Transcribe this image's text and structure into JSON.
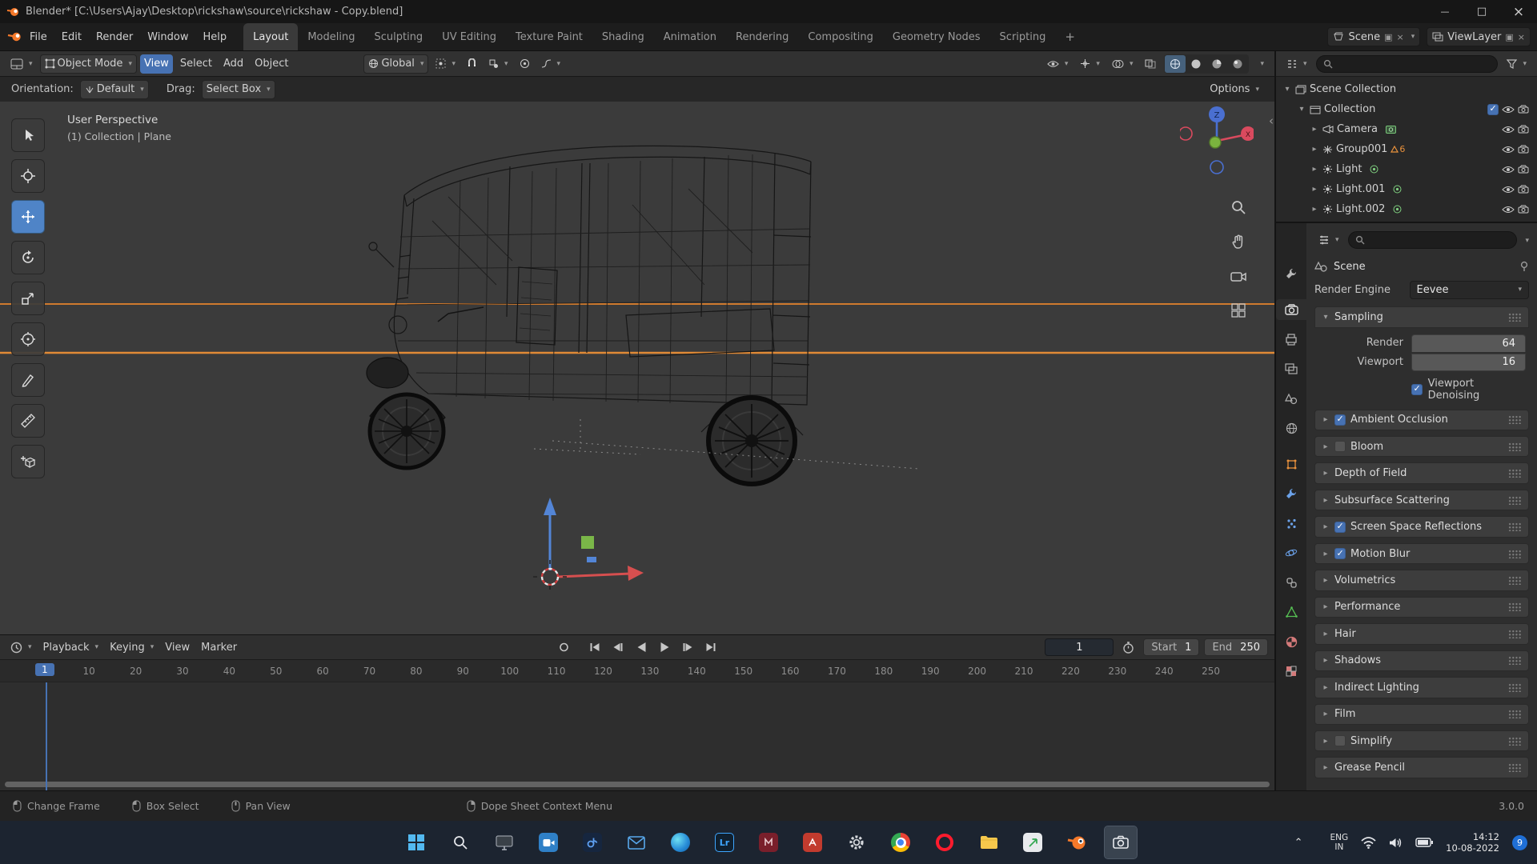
{
  "titlebar": {
    "title": "Blender* [C:\\Users\\Ajay\\Desktop\\rickshaw\\source\\rickshaw - Copy.blend]"
  },
  "topbar": {
    "menus": [
      "File",
      "Edit",
      "Render",
      "Window",
      "Help"
    ],
    "workspaces": [
      "Layout",
      "Modeling",
      "Sculpting",
      "UV Editing",
      "Texture Paint",
      "Shading",
      "Animation",
      "Rendering",
      "Compositing",
      "Geometry Nodes",
      "Scripting"
    ],
    "add_workspace": "+",
    "scene_selector": {
      "label": "Scene"
    },
    "viewlayer_selector": {
      "label": "ViewLayer"
    }
  },
  "viewport": {
    "header": {
      "mode": "Object Mode",
      "menus": [
        "View",
        "Select",
        "Add",
        "Object"
      ],
      "orientation": "Global"
    },
    "toolbar_row": {
      "orientation_label": "Orientation:",
      "orientation_value": "Default",
      "drag_label": "Drag:",
      "drag_value": "Select Box",
      "options_label": "Options"
    },
    "overlay": {
      "view_label": "User Perspective",
      "context_label": "(1) Collection | Plane"
    },
    "gizmo": {
      "z": "Z",
      "x": "X"
    }
  },
  "outliner": {
    "collection_checked": true,
    "items": [
      {
        "label": "Scene Collection"
      },
      {
        "label": "Collection"
      },
      {
        "label": "Camera"
      },
      {
        "label": "Group001",
        "badge": "6"
      },
      {
        "label": "Light"
      },
      {
        "label": "Light.001"
      },
      {
        "label": "Light.002"
      }
    ]
  },
  "properties": {
    "breadcrumb": "Scene",
    "render_engine_label": "Render Engine",
    "render_engine_value": "Eevee",
    "sampling": {
      "title": "Sampling",
      "render_label": "Render",
      "render_value": "64",
      "viewport_label": "Viewport",
      "viewport_value": "16",
      "denoise_label": "Viewport Denoising",
      "denoise_checked": true
    },
    "sections": [
      {
        "label": "Ambient Occlusion",
        "has_checkbox": true,
        "checked": true
      },
      {
        "label": "Bloom",
        "has_checkbox": true,
        "checked": false
      },
      {
        "label": "Depth of Field",
        "has_checkbox": false
      },
      {
        "label": "Subsurface Scattering",
        "has_checkbox": false
      },
      {
        "label": "Screen Space Reflections",
        "has_checkbox": true,
        "checked": true
      },
      {
        "label": "Motion Blur",
        "has_checkbox": true,
        "checked": true
      },
      {
        "label": "Volumetrics",
        "has_checkbox": false
      },
      {
        "label": "Performance",
        "has_checkbox": false
      },
      {
        "label": "Hair",
        "has_checkbox": false
      },
      {
        "label": "Shadows",
        "has_checkbox": false
      },
      {
        "label": "Indirect Lighting",
        "has_checkbox": false
      },
      {
        "label": "Film",
        "has_checkbox": false
      },
      {
        "label": "Simplify",
        "has_checkbox": true,
        "checked": false
      },
      {
        "label": "Grease Pencil",
        "has_checkbox": false
      }
    ]
  },
  "timeline": {
    "menus": [
      "Playback",
      "Keying",
      "View",
      "Marker"
    ],
    "current_frame": "1",
    "frame_field": "1",
    "start_label": "Start",
    "start_value": "1",
    "end_label": "End",
    "end_value": "250",
    "ticks": [
      "10",
      "20",
      "30",
      "40",
      "50",
      "60",
      "70",
      "80",
      "90",
      "100",
      "110",
      "120",
      "130",
      "140",
      "150",
      "160",
      "170",
      "180",
      "190",
      "200",
      "210",
      "220",
      "230",
      "240",
      "250"
    ]
  },
  "statusbar": {
    "hints": [
      "Change Frame",
      "Box Select",
      "Pan View",
      "Dope Sheet Context Menu"
    ],
    "version": "3.0.0"
  },
  "taskbar": {
    "app_labels": {
      "lightroom": "Lr"
    },
    "tray": {
      "lang_line1": "ENG",
      "lang_line2": "IN",
      "time": "14:12",
      "date": "10-08-2022",
      "badge": "9"
    }
  }
}
